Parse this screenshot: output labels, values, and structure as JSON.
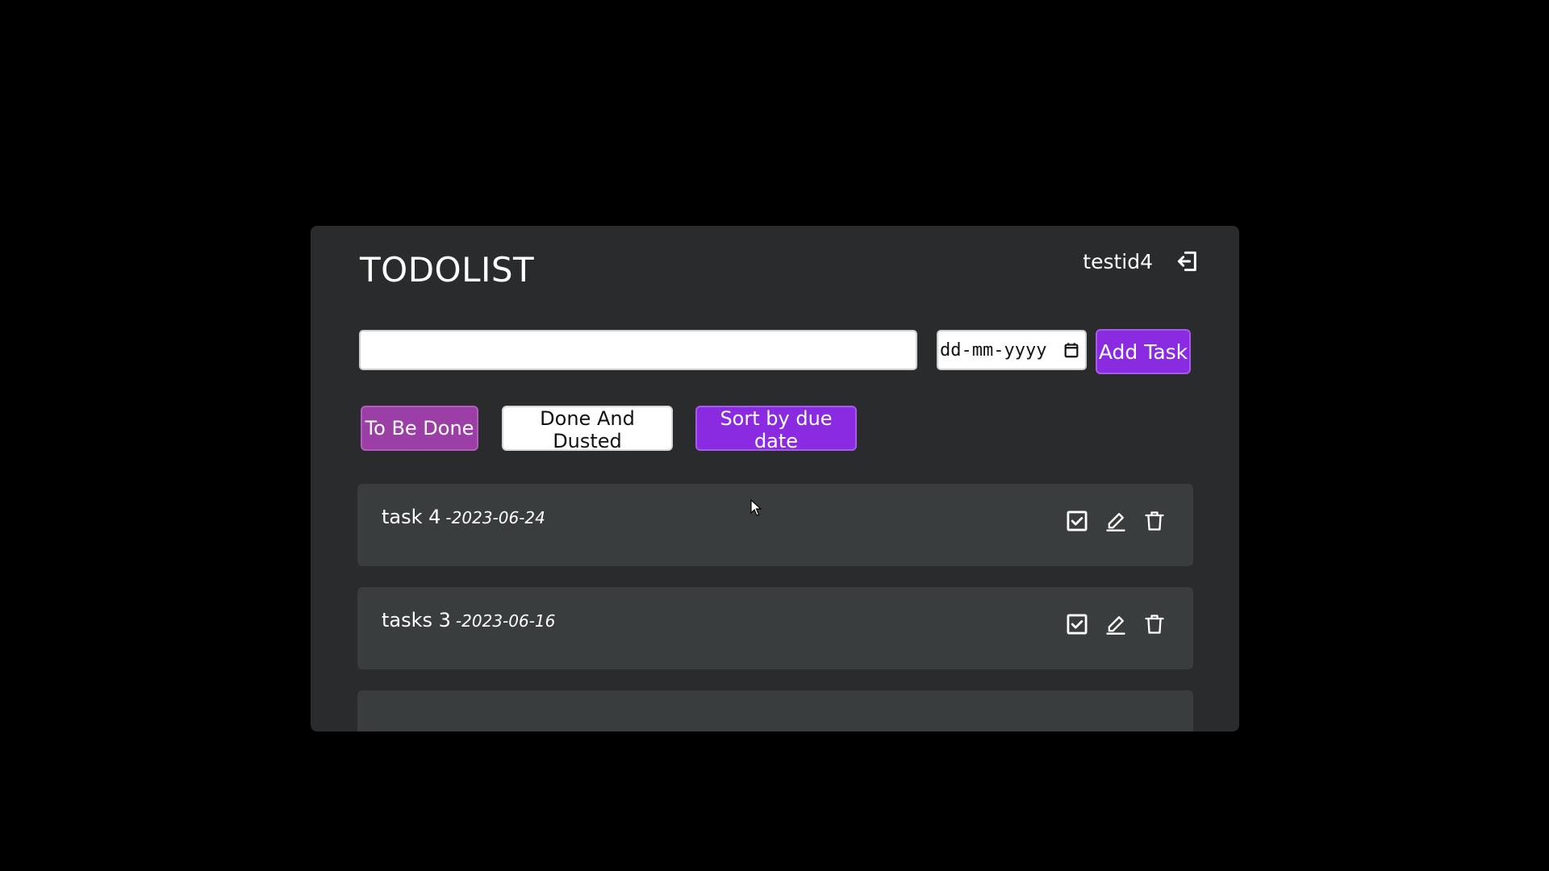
{
  "app": {
    "title": "TODOLIST"
  },
  "header": {
    "username": "testid4",
    "logout_icon": "logout-icon"
  },
  "task_form": {
    "task_value": "",
    "task_placeholder": "",
    "date_placeholder": "dd-mm-yyyy",
    "calendar_icon": "calendar-icon",
    "add_label": "Add Task"
  },
  "filters": {
    "todo_label": "To Be Done",
    "done_label": "Done And Dusted",
    "sort_label": "Sort by due date"
  },
  "tasks": [
    {
      "name": "task 4",
      "date": "-2023-06-24"
    },
    {
      "name": "tasks 3",
      "date": "-2023-06-16"
    }
  ],
  "task_actions": {
    "complete_icon": "check-square-icon",
    "edit_icon": "pencil-icon",
    "delete_icon": "trash-icon"
  },
  "colors": {
    "page_background": "#000000",
    "card_background": "#2a2b2c",
    "task_background": "#3a3d3d",
    "accent_purple": "#8a2be2",
    "todo_button": "#9b3fa6",
    "text": "#ffffff"
  }
}
